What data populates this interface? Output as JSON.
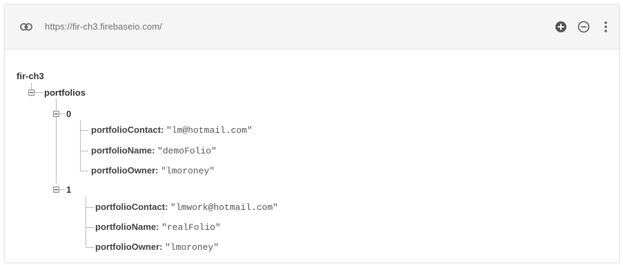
{
  "toolbar": {
    "url": "https://fir-ch3.firebaseio.com/",
    "icons": [
      "link-icon",
      "add-icon",
      "remove-icon",
      "more-vert-icon"
    ]
  },
  "tree": {
    "root": "fir-ch3",
    "node": "portfolios",
    "items": [
      {
        "index": "0",
        "fields": [
          {
            "key": "portfolioContact:",
            "value": "\"lm@hotmail.com\""
          },
          {
            "key": "portfolioName:",
            "value": "\"demoFolio\""
          },
          {
            "key": "portfolioOwner:",
            "value": "\"lmoroney\""
          }
        ]
      },
      {
        "index": "1",
        "fields": [
          {
            "key": "portfolioContact:",
            "value": "\"lmwork@hotmail.com\""
          },
          {
            "key": "portfolioName:",
            "value": "\"realFolio\""
          },
          {
            "key": "portfolioOwner:",
            "value": "\"lmoroney\""
          }
        ]
      }
    ]
  }
}
